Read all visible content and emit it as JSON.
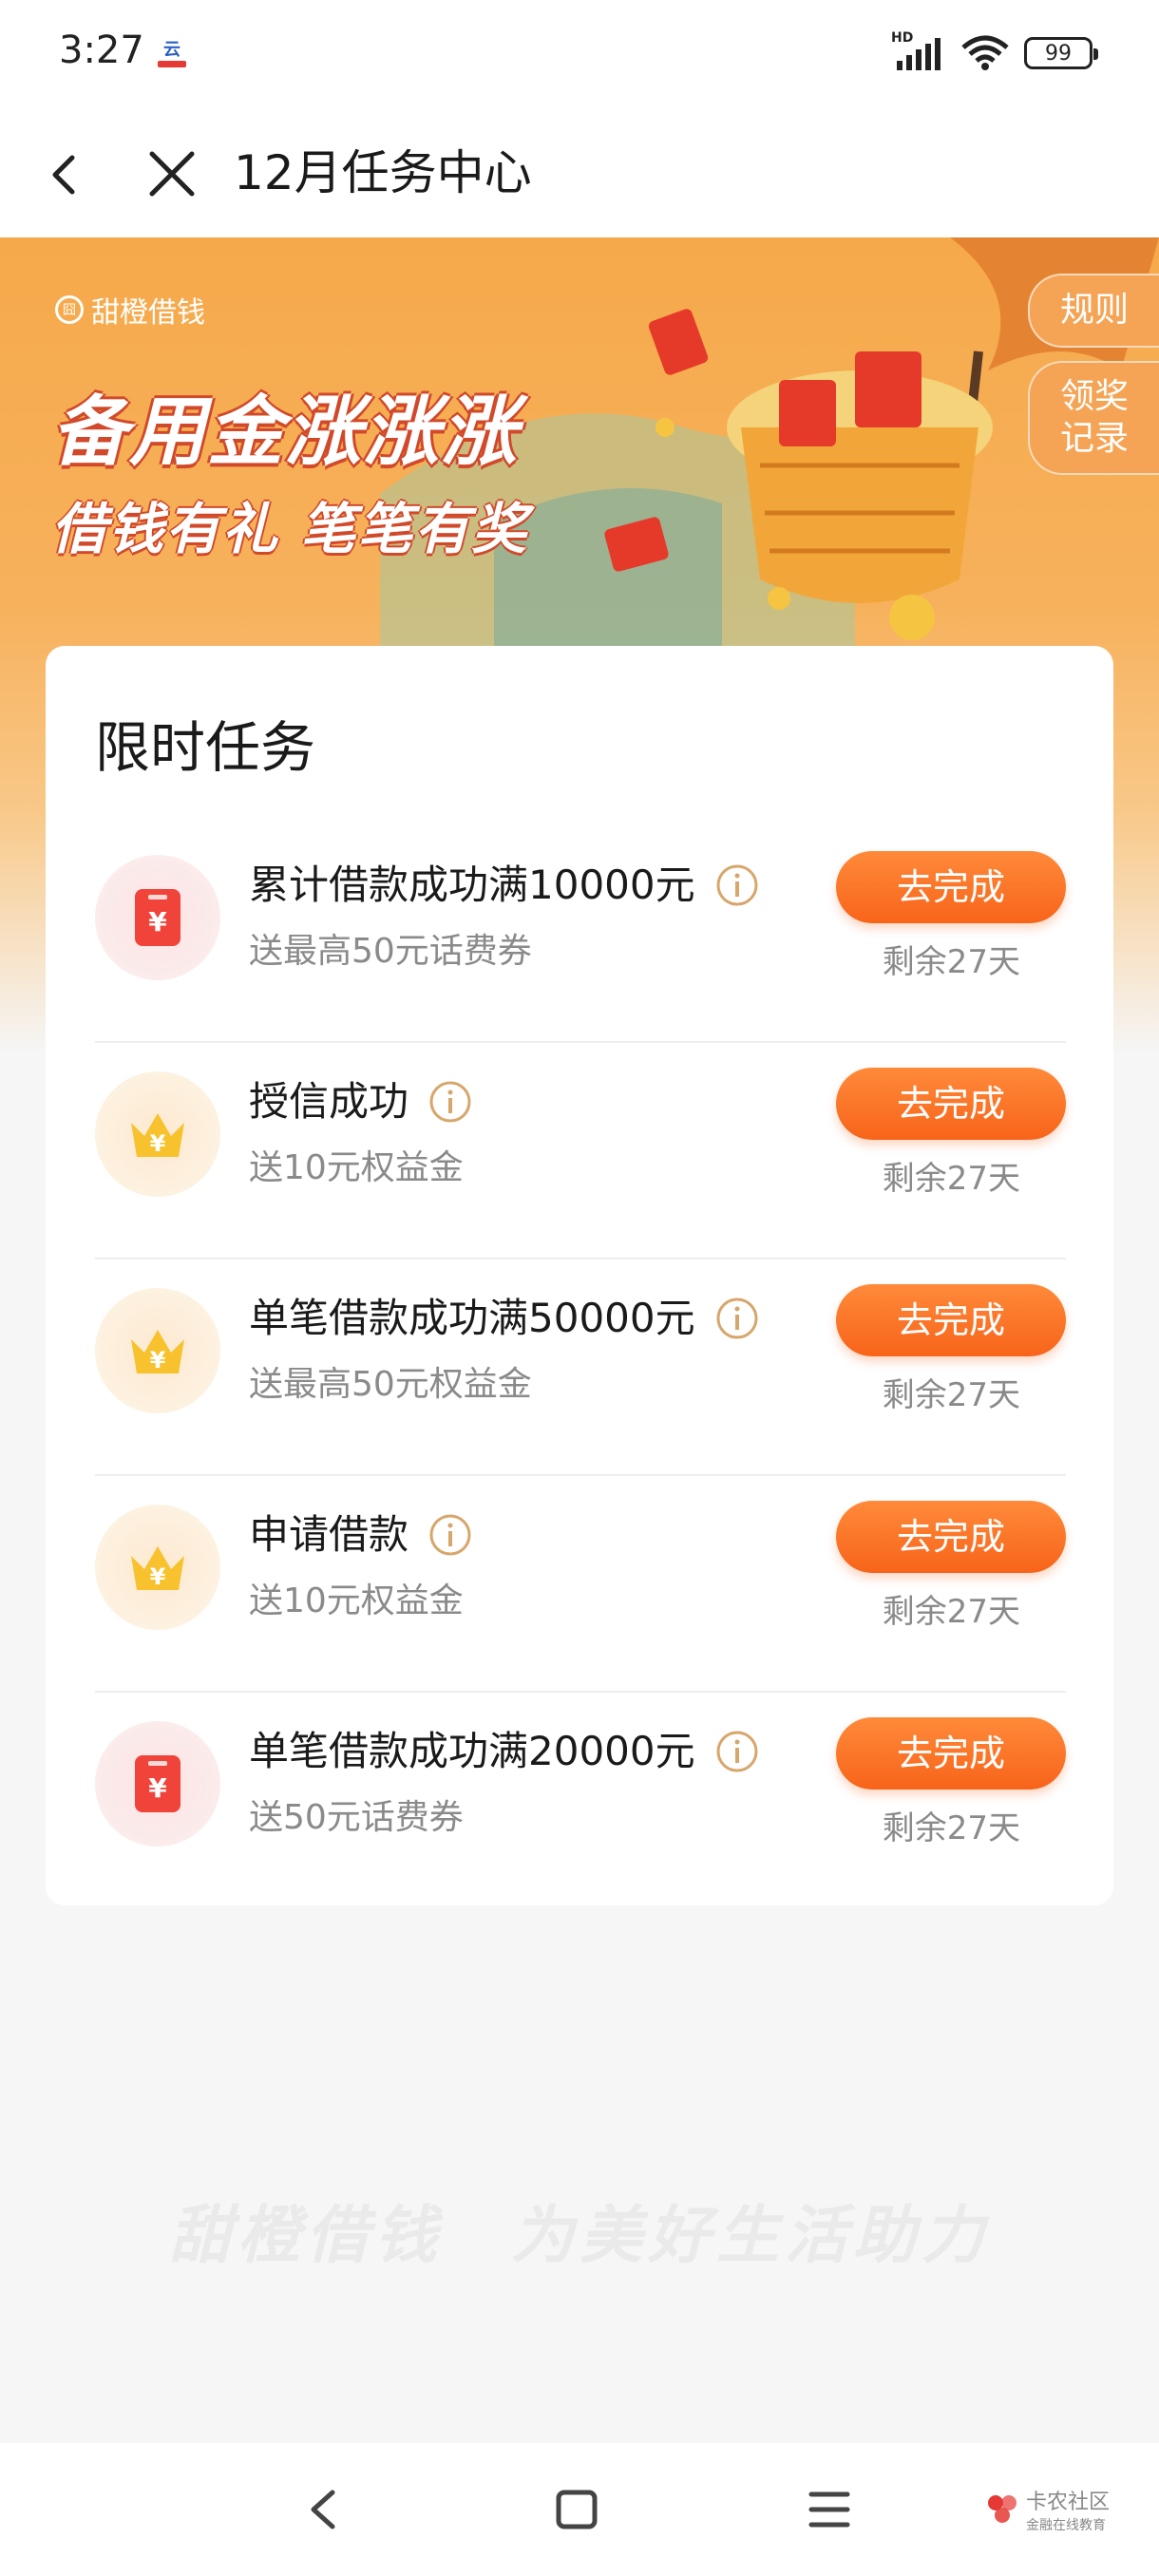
{
  "status_bar": {
    "time": "3:27",
    "network": "HD",
    "battery": "99"
  },
  "nav": {
    "title": "12月任务中心",
    "icons": [
      "back-icon",
      "close-icon"
    ]
  },
  "banner": {
    "brand": "甜橙借钱",
    "headline": "备用金涨涨涨",
    "subheadline": "借钱有礼 笔笔有奖",
    "rules_label": "规则",
    "records_label_line1": "领奖",
    "records_label_line2": "记录"
  },
  "card": {
    "title": "限时任务",
    "tasks": [
      {
        "title": "累计借款成功满10000元",
        "reward": "送最高50元话费券",
        "button": "去完成",
        "remain": "剩余27天",
        "icon": "phone-voucher-icon"
      },
      {
        "title": "授信成功",
        "reward": "送10元权益金",
        "button": "去完成",
        "remain": "剩余27天",
        "icon": "crown-coin-icon"
      },
      {
        "title": "单笔借款成功满50000元",
        "reward": "送最高50元权益金",
        "button": "去完成",
        "remain": "剩余27天",
        "icon": "crown-coin-icon"
      },
      {
        "title": "申请借款",
        "reward": "送10元权益金",
        "button": "去完成",
        "remain": "剩余27天",
        "icon": "crown-coin-icon"
      },
      {
        "title": "单笔借款成功满20000元",
        "reward": "送50元话费券",
        "button": "去完成",
        "remain": "剩余27天",
        "icon": "phone-voucher-icon"
      }
    ]
  },
  "slogan": "甜橙借钱　为美好生活助力",
  "watermark": {
    "line1": "卡农社区",
    "line2": "金融在线教育"
  },
  "colors": {
    "accent": "#f7641a",
    "banner": "#f6a94a",
    "red_icon": "#f0433a",
    "gold_icon": "#f7c22e"
  }
}
